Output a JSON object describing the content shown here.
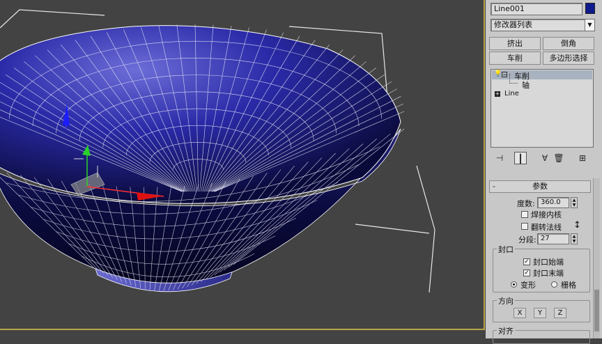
{
  "object_name": "Line001",
  "object_color": "#0f1a8c",
  "modifier_list": "修改器列表",
  "quick_buttons": [
    "挤出",
    "倒角",
    "车削",
    "多边形选择"
  ],
  "stack": {
    "items": [
      {
        "label": "车削",
        "selected": true
      },
      {
        "label": "轴",
        "sub": true
      },
      {
        "label": "Line"
      }
    ]
  },
  "toolbar_icons": [
    "pin-stack-icon",
    "show-end-result-icon",
    "make-unique-icon",
    "remove-modifier-icon",
    "configure-sets-icon"
  ],
  "params": {
    "title": "参数",
    "degrees_label": "度数:",
    "degrees_value": "360.0",
    "weld_core": "焊接内核",
    "flip_normals": "翻转法线",
    "segments_label": "分段:",
    "segments_value": "27",
    "capping": {
      "title": "封口",
      "cap_start": "封口始端",
      "cap_end": "封口末端",
      "morph": "变形",
      "grid": "栅格"
    },
    "direction": {
      "title": "方向",
      "x": "X",
      "y": "Y",
      "z": "Z"
    },
    "align": {
      "title": "对齐"
    }
  },
  "colors": {
    "viewport_bg": "#434343",
    "mesh_fill": "#1a1a9a",
    "active_border": "#b8a64a"
  }
}
